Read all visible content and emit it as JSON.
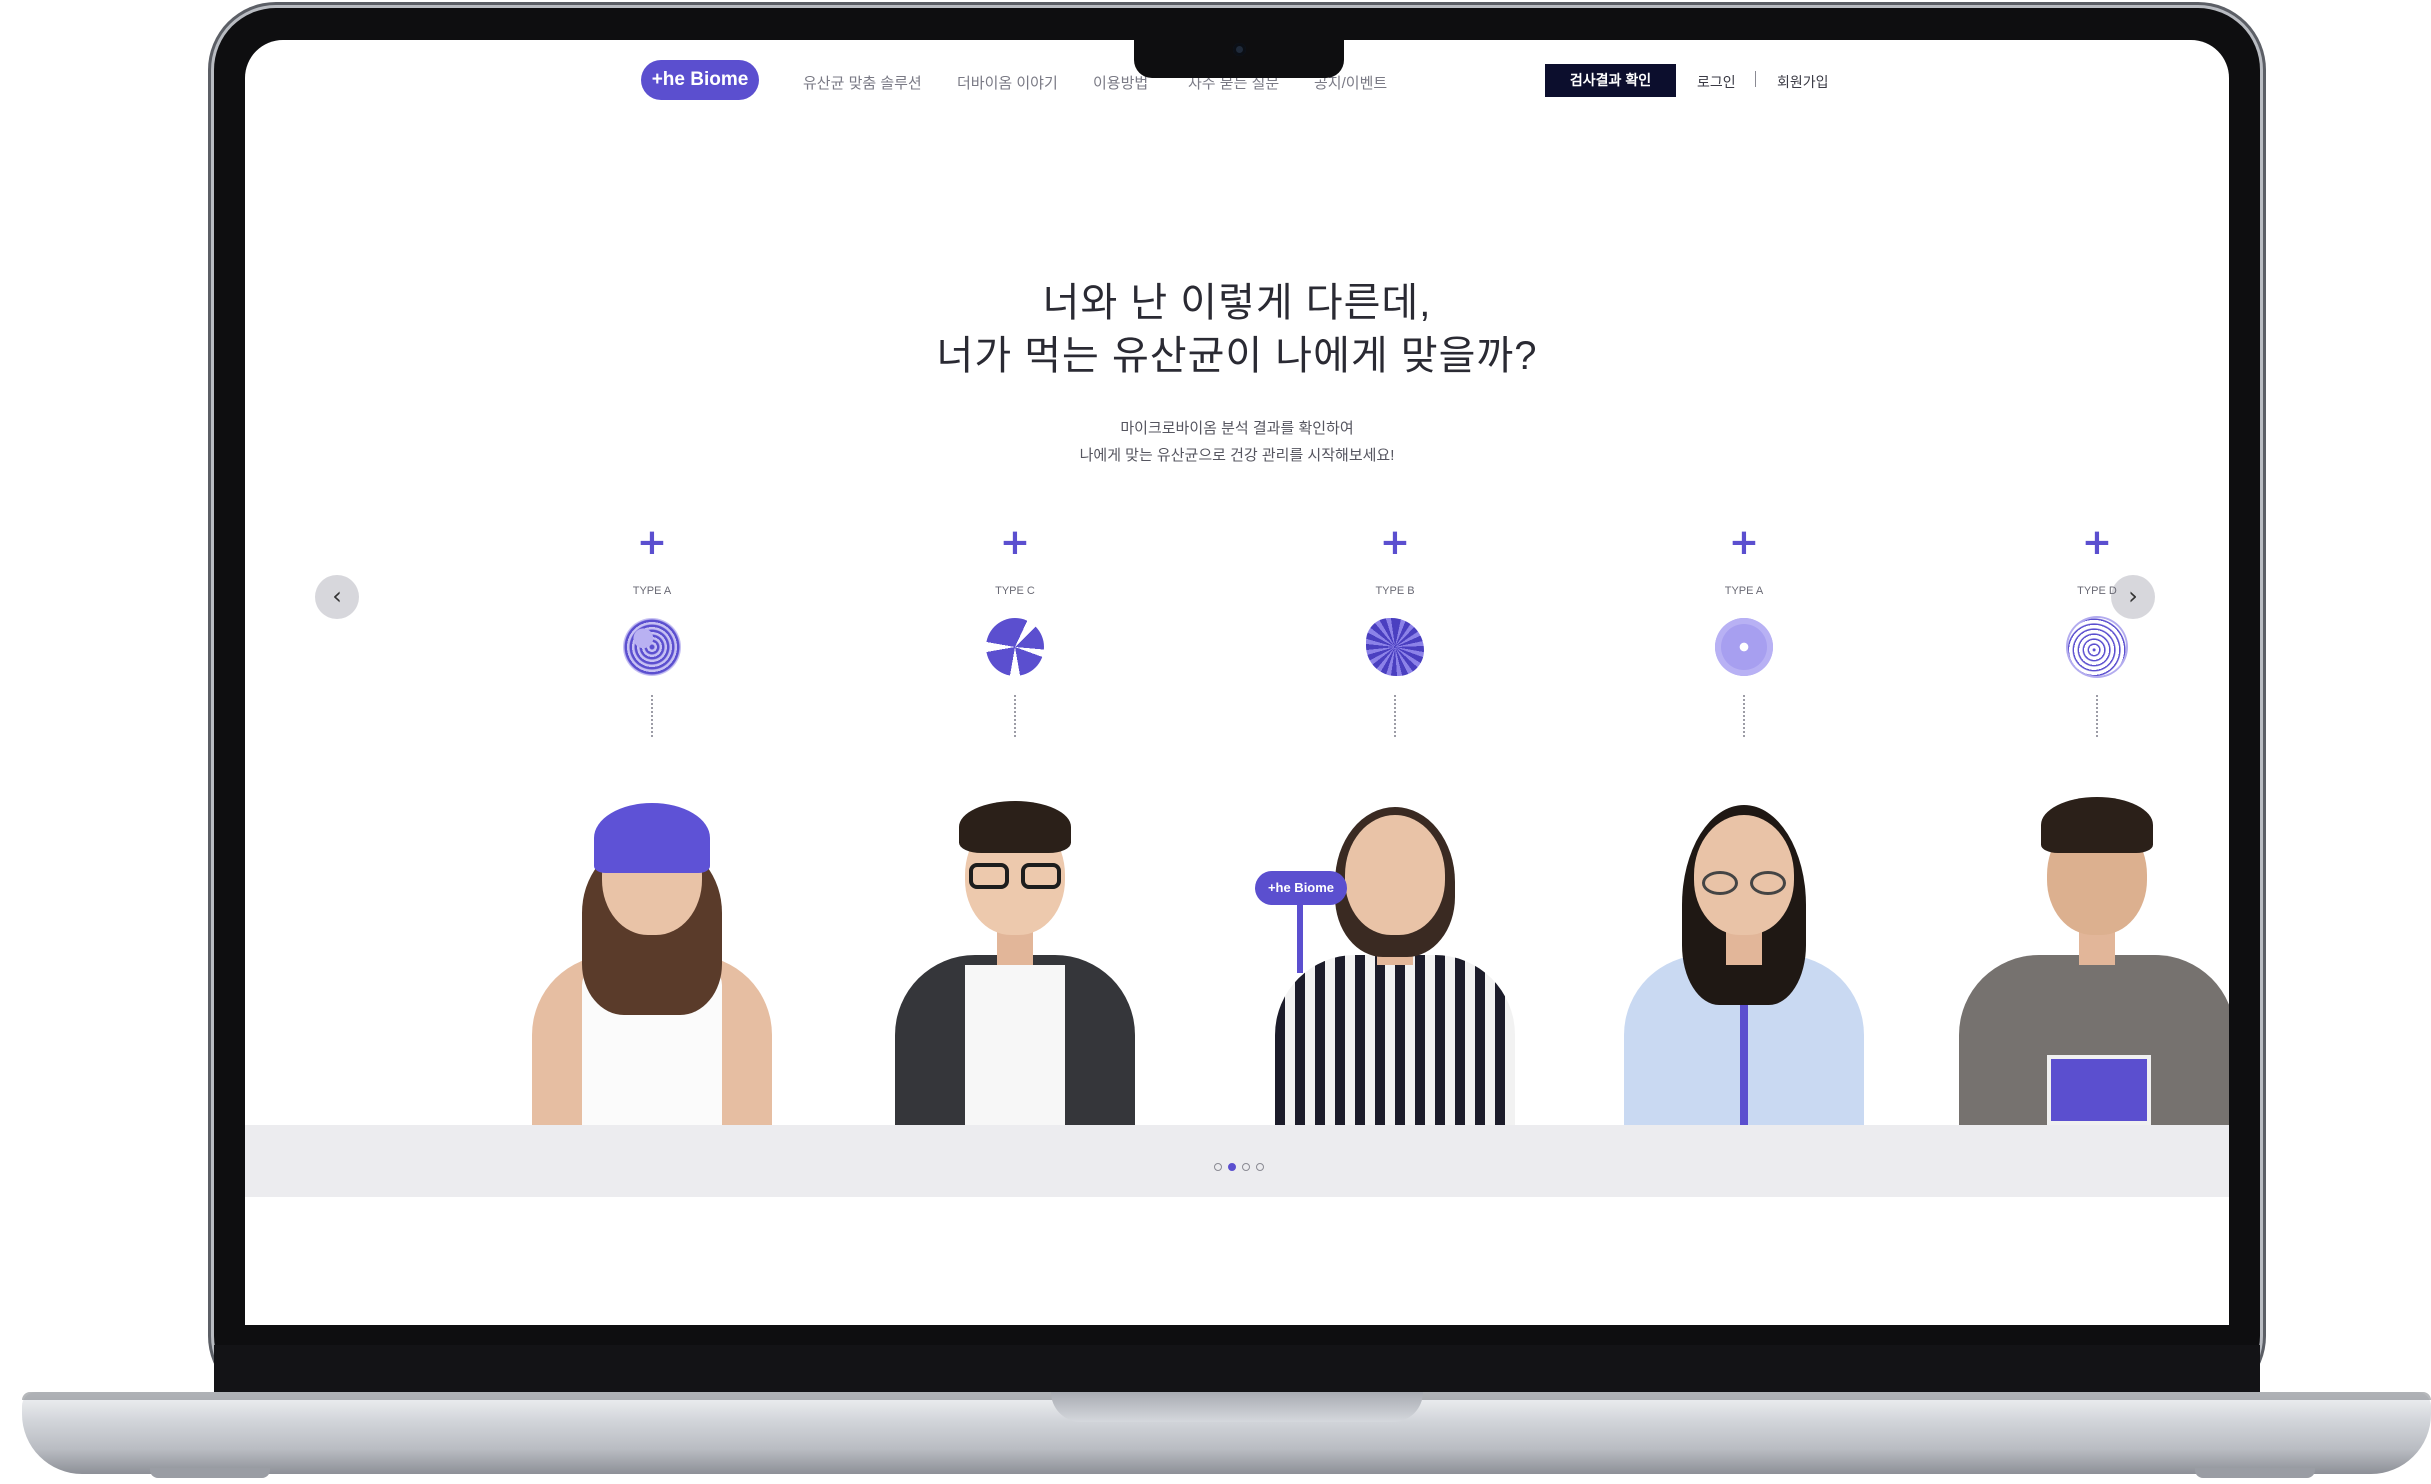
{
  "header": {
    "logo": "+he Biome",
    "nav": [
      "유산균 맞춤 솔루션",
      "더바이옴 이야기",
      "이용방법",
      "자주 묻는 질문",
      "공지/이벤트"
    ],
    "cta": "검사결과 확인",
    "login": "로그인",
    "signup": "회원가입"
  },
  "hero": {
    "headline_line1": "너와 난 이렇게 다른데,",
    "headline_line2": "너가 먹는 유산균이 나에게 맞을까?",
    "sub_line1": "마이크로바이옴 분석 결과를 확인하여",
    "sub_line2": "나에게 맞는 유산균으로 건강 관리를 시작해보세요!"
  },
  "carousel": {
    "prev_icon": "chevron-left-icon",
    "next_icon": "chevron-right-icon",
    "plus_symbol": "+",
    "prev_glyph": "‹",
    "next_glyph": "›",
    "items": [
      {
        "type": "TYPE A",
        "accent": "#5b4fcf"
      },
      {
        "type": "TYPE C",
        "accent": "#5b4fcf"
      },
      {
        "type": "TYPE B",
        "accent": "#5b4fcf"
      },
      {
        "type": "TYPE A",
        "accent": "#7a6fe0"
      },
      {
        "type": "TYPE D",
        "accent": "#5b4fcf"
      }
    ],
    "sign_text": "+he Biome",
    "pages": 4,
    "active_page": 2
  },
  "colors": {
    "brand": "#5b4fcf",
    "cta_bg": "#0c0e2d"
  }
}
